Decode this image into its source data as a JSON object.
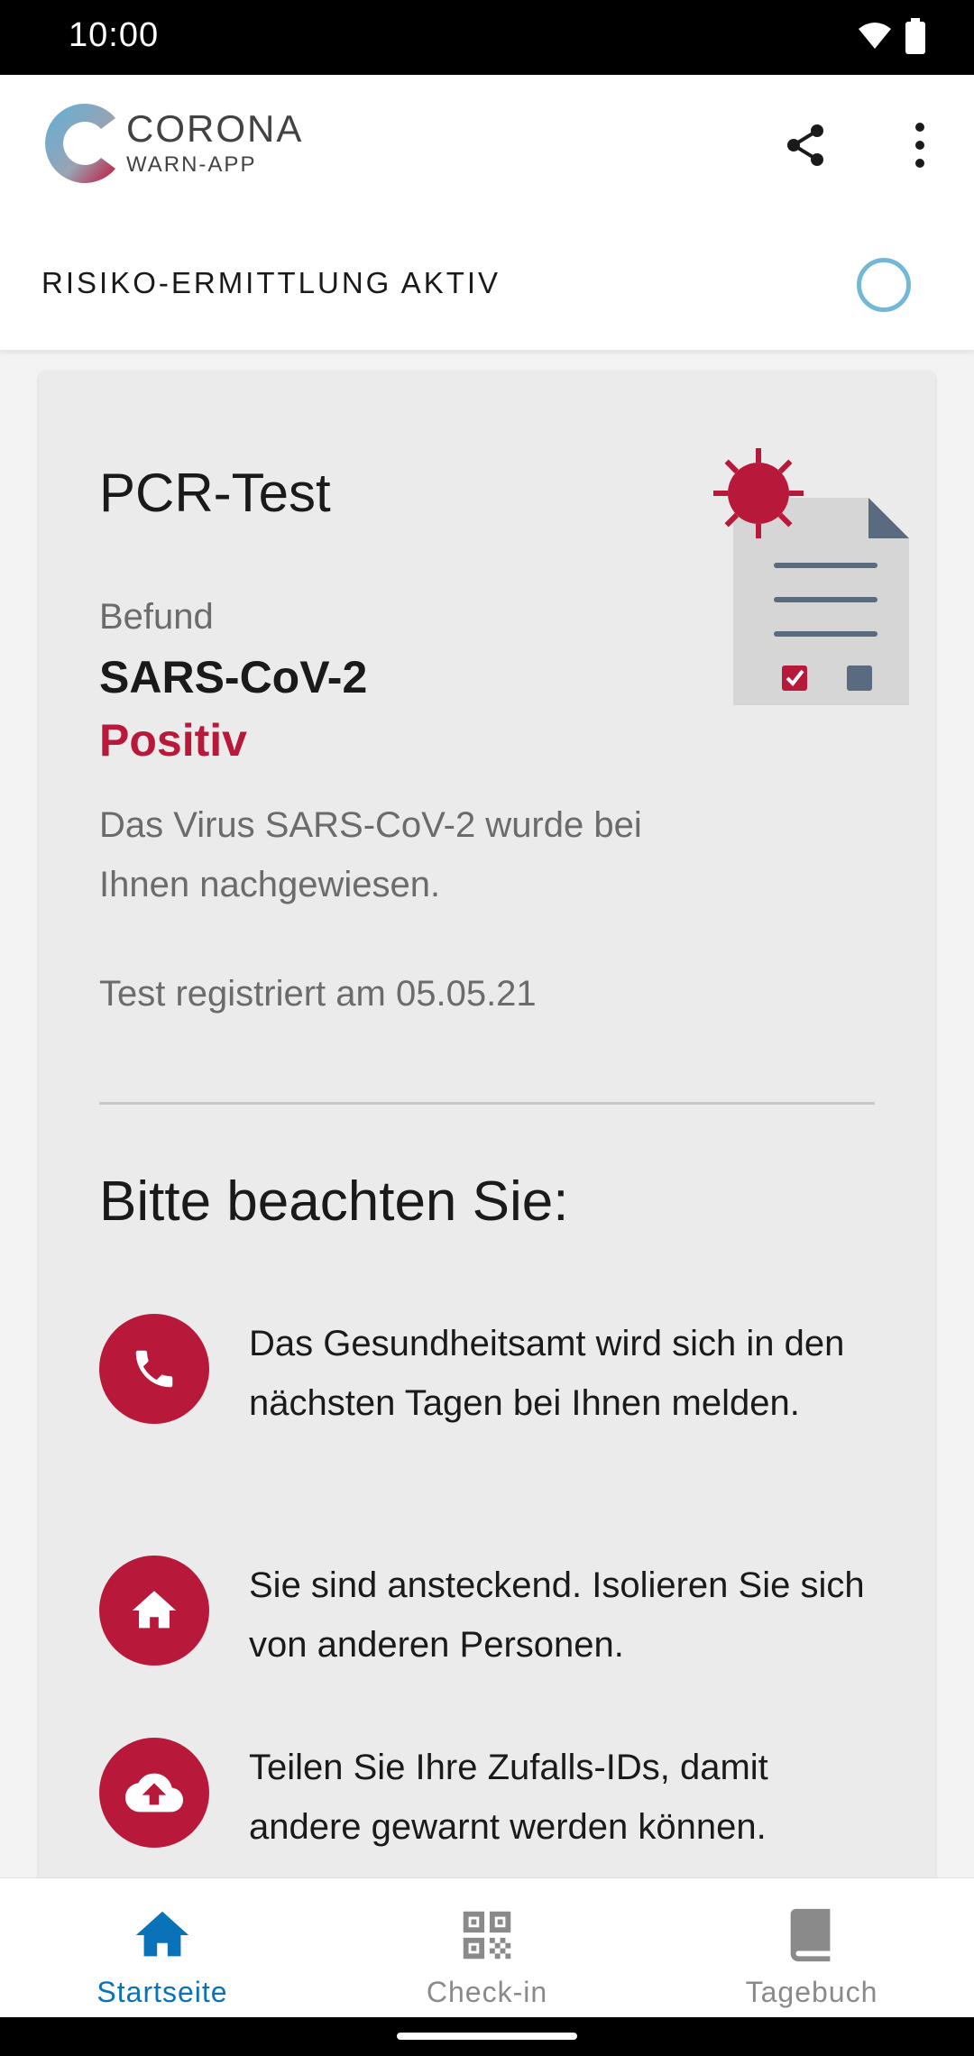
{
  "status_bar": {
    "time": "10:00"
  },
  "app_bar": {
    "logo_line1": "CORONA",
    "logo_line2": "WARN-APP"
  },
  "risk_bar": {
    "label": "RISIKO-ERMITTLUNG AKTIV"
  },
  "card": {
    "title": "PCR-Test",
    "befund_label": "Befund",
    "virus_name": "SARS-CoV-2",
    "result": "Positiv",
    "result_description": "Das Virus SARS-CoV-2 wurde bei Ihnen nachgewiesen.",
    "registration": "Test registriert am 05.05.21",
    "notice_title": "Bitte beachten Sie:",
    "notices": [
      {
        "icon": "phone-icon",
        "text": "Das Gesundheitsamt wird sich in den nächsten Tagen bei Ihnen melden."
      },
      {
        "icon": "home-icon",
        "text": "Sie sind ansteckend. Isolieren Sie sich von anderen Personen."
      },
      {
        "icon": "cloud-upload-icon",
        "text": "Teilen Sie Ihre Zufalls-IDs, damit andere gewarnt werden können."
      }
    ]
  },
  "bottom_nav": {
    "items": [
      {
        "label": "Startseite",
        "icon": "home-icon",
        "active": true
      },
      {
        "label": "Check-in",
        "icon": "qr-code-icon",
        "active": false
      },
      {
        "label": "Tagebuch",
        "icon": "book-icon",
        "active": false
      }
    ]
  },
  "colors": {
    "accent_red": "#b8193a",
    "nav_active": "#0a72b8",
    "nav_inactive": "#8a8a8a",
    "spinner": "#74b8d8"
  }
}
